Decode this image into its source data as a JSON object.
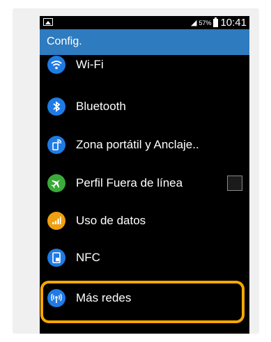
{
  "status_bar": {
    "battery_percent": "57%",
    "time": "10:41"
  },
  "app_bar": {
    "title": "Config."
  },
  "settings": [
    {
      "label": "Wi-Fi",
      "icon": "wifi-icon",
      "color": "#1f7be4"
    },
    {
      "label": "Bluetooth",
      "icon": "bluetooth-icon",
      "color": "#1f7be4"
    },
    {
      "label": "Zona portátil y Anclaje..",
      "icon": "hotspot-icon",
      "color": "#1f7be4"
    },
    {
      "label": "Perfil Fuera de línea",
      "icon": "airplane-icon",
      "color": "#3aaa3a",
      "checkbox_checked": false
    },
    {
      "label": "Uso de datos",
      "icon": "data-usage-icon",
      "color": "#f0a010"
    },
    {
      "label": "NFC",
      "icon": "nfc-icon",
      "color": "#1f7be4"
    },
    {
      "label": "Más redes",
      "icon": "more-networks-icon",
      "color": "#1f7be4",
      "highlighted": true
    }
  ],
  "highlight_color": "#f5a800",
  "app_bar_color": "#2e7bbf"
}
